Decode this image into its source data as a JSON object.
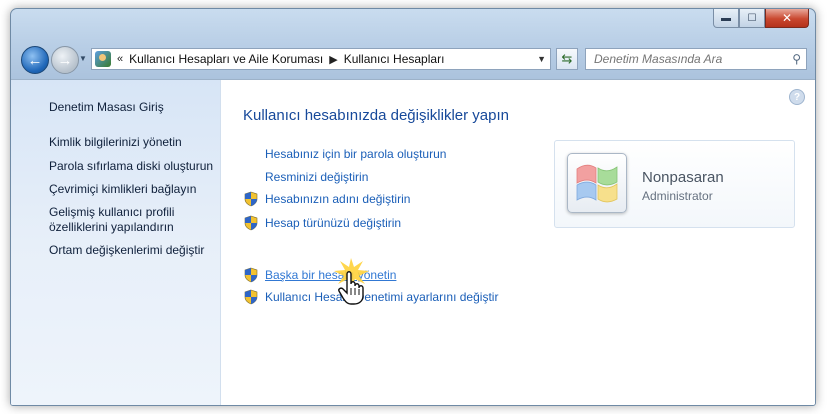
{
  "window": {
    "close_symbol": "✕",
    "min_symbol": "▬",
    "max_symbol": "☐"
  },
  "toolbar": {
    "back_icon": "arrow-left-icon",
    "forward_icon": "arrow-right-icon",
    "breadcrumb_prefix": "«",
    "breadcrumb": [
      "Kullanıcı Hesapları ve Aile Koruması",
      "Kullanıcı Hesapları"
    ],
    "search_placeholder": "Denetim Masasında Ara"
  },
  "left_pane": {
    "home_link": "Denetim Masası Giriş",
    "links": [
      "Kimlik bilgilerinizi yönetin",
      "Parola sıfırlama diski oluşturun",
      "Çevrimiçi kimlikleri bağlayın",
      "Gelişmiş kullanıcı profili",
      "özelliklerini yapılandırın",
      "Ortam değişkenlerimi değiştir"
    ]
  },
  "main": {
    "help_symbol": "?",
    "title": "Kullanıcı hesabınızda değişiklikler yapın",
    "tasks": [
      {
        "label": "Hesabınız için bir parola oluşturun",
        "shield": false
      },
      {
        "label": "Resminizi değiştirin",
        "shield": false
      },
      {
        "label": "Hesabınızın adını değiştirin",
        "shield": true
      },
      {
        "label": "Hesap türünüzü değiştirin",
        "shield": true
      }
    ],
    "other_tasks": [
      {
        "label": "Başka bir hesabı yönetin",
        "shield": true,
        "hover": true
      },
      {
        "label": "Kullanıcı Hesabı Denetimi ayarlarını değiştir",
        "shield": true
      }
    ]
  },
  "account": {
    "name": "Nonpasaran",
    "role": "Administrator"
  },
  "colors": {
    "link": "#1b5fb8",
    "title": "#17499a",
    "shield_blue": "#2f66c7",
    "shield_yellow": "#f2c230"
  }
}
